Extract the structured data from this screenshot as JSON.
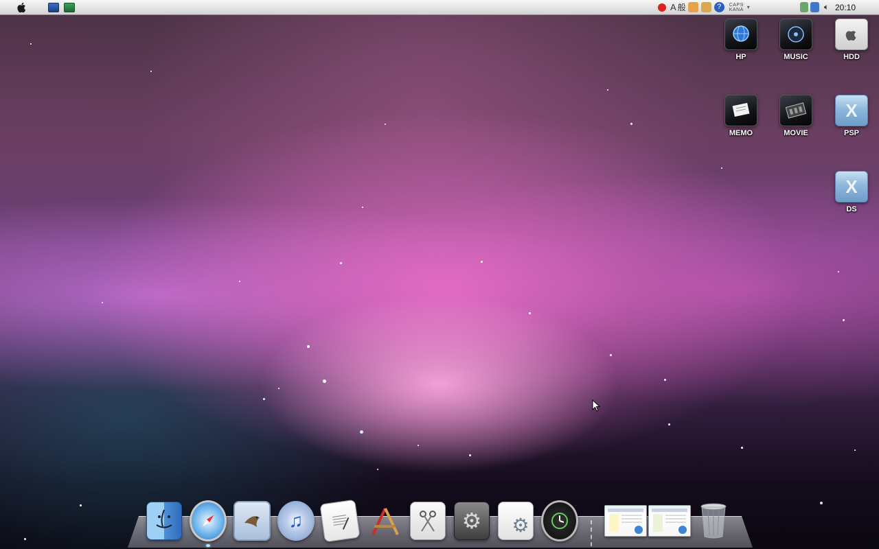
{
  "menubar": {
    "apple_icon": "apple-icon",
    "ime": {
      "caps": "CAPS",
      "kana": "KANA",
      "mode_a": "A",
      "mode_kanji": "般"
    },
    "clock": "20:10"
  },
  "desktop_icons": [
    {
      "label": "HP"
    },
    {
      "label": "MUSIC"
    },
    {
      "label": "HDD"
    },
    {
      "label": "MEMO"
    },
    {
      "label": "MOVIE"
    },
    {
      "label": "PSP"
    },
    {
      "label": "DS"
    }
  ],
  "dock": {
    "items": [
      {
        "name": "finder-icon"
      },
      {
        "name": "safari-icon"
      },
      {
        "name": "mail-icon"
      },
      {
        "name": "itunes-icon"
      },
      {
        "name": "textedit-icon"
      },
      {
        "name": "xcode-icon"
      },
      {
        "name": "preview-icon"
      },
      {
        "name": "system-preferences-icon"
      },
      {
        "name": "script-icon"
      },
      {
        "name": "time-machine-icon"
      },
      {
        "name": "window-1-icon"
      },
      {
        "name": "window-2-icon"
      },
      {
        "name": "trash-icon"
      }
    ]
  },
  "colors": {
    "menubar": "#e2e2e2",
    "label_text": "#ffffff",
    "folder_blue": "#8eb7dc",
    "folder_dark": "#121418"
  }
}
